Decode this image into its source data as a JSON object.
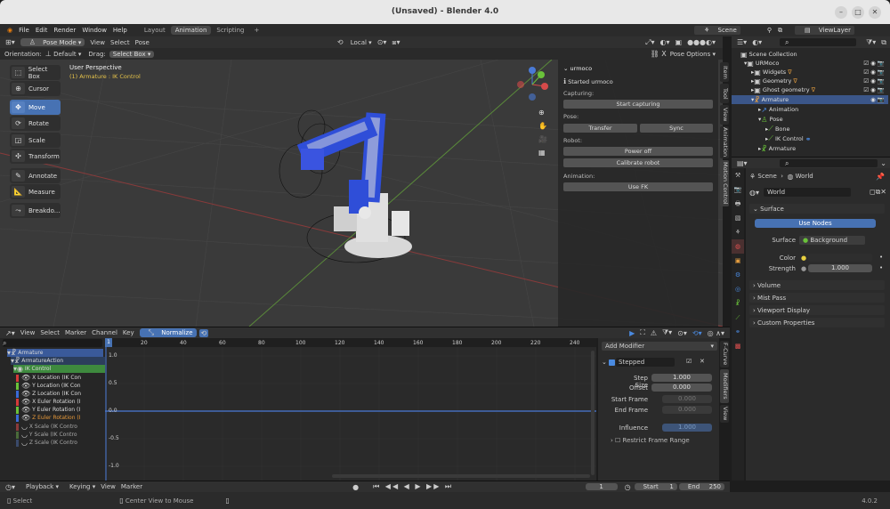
{
  "window": {
    "title": "(Unsaved) - Blender 4.0",
    "minimize": "–",
    "maximize": "□",
    "close": "✕"
  },
  "menu": {
    "items": [
      "File",
      "Edit",
      "Render",
      "Window",
      "Help"
    ],
    "workspaces": [
      "Layout",
      "Animation",
      "Scripting",
      "+"
    ],
    "scene": "Scene",
    "view_layer": "ViewLayer"
  },
  "viewport_header": {
    "mode": "Pose Mode",
    "menus": [
      "View",
      "Select",
      "Pose"
    ],
    "transform": "Local",
    "orientation_label": "Orientation:",
    "orientation_value": "Default",
    "drag_label": "Drag:",
    "drag_value": "Select Box",
    "pose_options": "Pose Options"
  },
  "viewport": {
    "perspective": "User Perspective",
    "object": "(1) Armature : IK Control"
  },
  "tools": [
    "Select Box",
    "Cursor",
    "Move",
    "Rotate",
    "Scale",
    "Transform",
    "Annotate",
    "Measure",
    "Breakdo..."
  ],
  "urmoco": {
    "title": "urmoco",
    "status": "Started urmoco",
    "capturing_label": "Capturing:",
    "start_capturing": "Start capturing",
    "pose_label": "Pose:",
    "transfer": "Transfer",
    "sync": "Sync",
    "robot_label": "Robot:",
    "power_off": "Power off",
    "calibrate": "Calibrate robot",
    "animation_label": "Animation:",
    "use_fk": "Use FK"
  },
  "side_tabs": [
    "Item",
    "Tool",
    "View",
    "Animation",
    "Motion Control"
  ],
  "graph_header": {
    "menus": [
      "View",
      "Select",
      "Marker",
      "Channel",
      "Key"
    ],
    "normalize": "Normalize"
  },
  "graph": {
    "ruler": [
      "20",
      "40",
      "60",
      "80",
      "100",
      "120",
      "140",
      "160",
      "180",
      "200",
      "220",
      "240"
    ],
    "current_frame": "1",
    "y_labels": [
      "1.0",
      "0.5",
      "0.0",
      "-0.5",
      "-1.0"
    ]
  },
  "channels": [
    {
      "name": "Armature",
      "color": "#3a5a9a"
    },
    {
      "name": "ArmatureAction",
      "color": ""
    },
    {
      "name": "IK Control",
      "color": "#3e8a3e"
    },
    {
      "name": "X Location (IK Con",
      "color": "#d63a3a"
    },
    {
      "name": "Y Location (IK Con",
      "color": "#6ac23a"
    },
    {
      "name": "Z Location (IK Con",
      "color": "#3a6ad6"
    },
    {
      "name": "X Euler Rotation (I",
      "color": "#d63a3a"
    },
    {
      "name": "Y Euler Rotation (I",
      "color": "#6ac23a"
    },
    {
      "name": "Z Euler Rotation (I",
      "color": "#3a6ad6"
    },
    {
      "name": "X Scale (IK Contro",
      "color": "#8a3a3a"
    },
    {
      "name": "Y Scale (IK Contro",
      "color": "#4a6a3a"
    },
    {
      "name": "Z Scale (IK Contro",
      "color": "#3a4a6a"
    }
  ],
  "modifier": {
    "add": "Add Modifier",
    "name": "Stepped",
    "step_size_label": "Step Size",
    "step_size": "1.000",
    "offset_label": "Offset",
    "offset": "0.000",
    "start_label": "Start Frame",
    "start": "0.000",
    "end_label": "End Frame",
    "end": "0.000",
    "influence_label": "Influence",
    "influence": "1.000",
    "restrict": "Restrict Frame Range",
    "tabs": [
      "F-Curve",
      "Modifiers",
      "View"
    ]
  },
  "timeline": {
    "menus": [
      "Playback",
      "Keying",
      "View",
      "Marker"
    ],
    "frame": "1",
    "start_label": "Start",
    "start": "1",
    "end_label": "End",
    "end": "250"
  },
  "statusbar": {
    "select": "Select",
    "center": "Center View to Mouse",
    "version": "4.0.2"
  },
  "outliner": {
    "rows": [
      {
        "label": "Scene Collection",
        "indent": 0
      },
      {
        "label": "URMoco",
        "indent": 1
      },
      {
        "label": "Widgets",
        "indent": 2
      },
      {
        "label": "Geometry",
        "indent": 2
      },
      {
        "label": "Ghost geometry",
        "indent": 2
      },
      {
        "label": "Armature",
        "indent": 2
      },
      {
        "label": "Animation",
        "indent": 3
      },
      {
        "label": "Pose",
        "indent": 3
      },
      {
        "label": "Bone",
        "indent": 4
      },
      {
        "label": "IK Control",
        "indent": 4
      },
      {
        "label": "Armature",
        "indent": 3
      }
    ]
  },
  "properties": {
    "breadcrumb_scene": "Scene",
    "breadcrumb_world": "World",
    "world": "World",
    "surface": "Surface",
    "use_nodes": "Use Nodes",
    "surface_label": "Surface",
    "surface_value": "Background",
    "color_label": "Color",
    "strength_label": "Strength",
    "strength": "1.000",
    "sections": [
      "Volume",
      "Mist Pass",
      "Viewport Display",
      "Custom Properties"
    ]
  },
  "colors": {
    "accent": "#4772b3",
    "header": "#303030",
    "panel": "#2b2b2b",
    "active_outliner": "#3b5689"
  }
}
